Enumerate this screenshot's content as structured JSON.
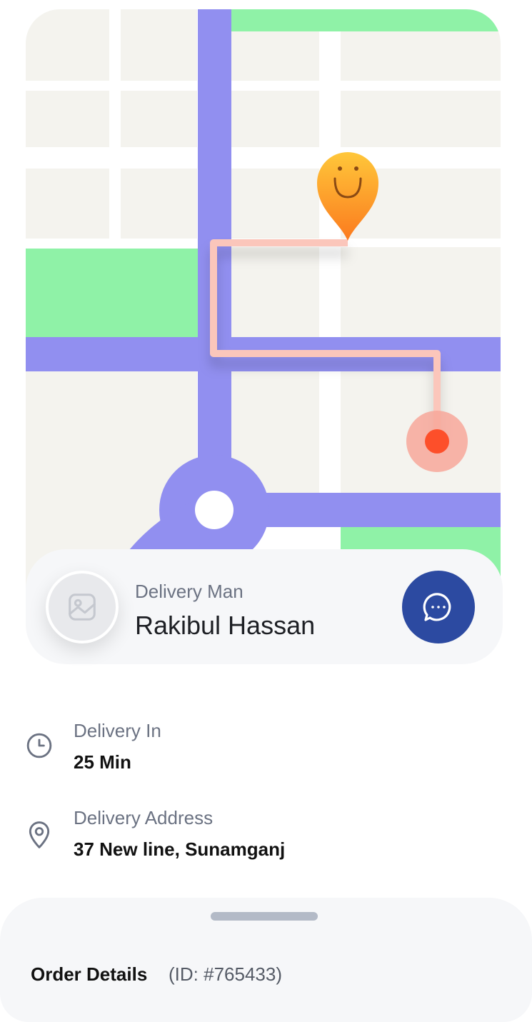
{
  "map": {
    "pin_icon": "smiley-location-pin-icon",
    "destination_icon": "destination-dot-icon",
    "colors": {
      "road": "#918ff0",
      "park": "#8ff2a7",
      "route": "#fbc6bb",
      "block": "#f4f3ee"
    }
  },
  "courier": {
    "label": "Delivery Man",
    "name": "Rakibul Hassan",
    "avatar_icon": "image-placeholder-icon",
    "chat_icon": "chat-bubble-icon",
    "chat_color": "#2c4aa1"
  },
  "delivery_time": {
    "label": "Delivery In",
    "value": "25 Min",
    "icon": "clock-icon"
  },
  "delivery_address": {
    "label": "Delivery Address",
    "value": "37 New line, Sunamganj",
    "icon": "location-pin-icon"
  },
  "order": {
    "title": "Order Details",
    "id_text": "(ID: #765433)"
  }
}
